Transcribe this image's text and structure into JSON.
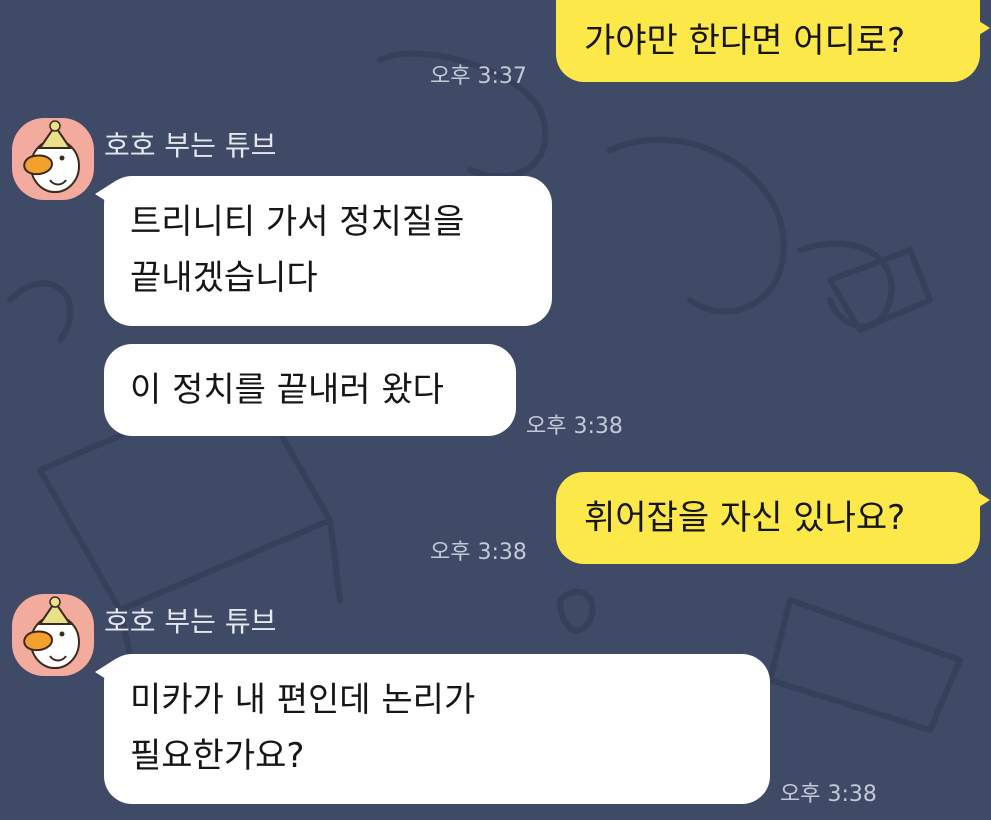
{
  "chat": {
    "sender_name": "호호 부는 튜브",
    "messages": [
      {
        "side": "sent",
        "lines": [
          "가야만 한다면 어디로?"
        ],
        "time": "오후 3:37"
      },
      {
        "side": "recv",
        "lines": [
          "트리니티 가서 정치질을",
          "끝내겠습니다"
        ]
      },
      {
        "side": "recv",
        "lines": [
          "이 정치를 끝내러 왔다"
        ],
        "time": "오후 3:38"
      },
      {
        "side": "sent",
        "lines": [
          "휘어잡을 자신 있나요?"
        ],
        "time": "오후 3:38"
      },
      {
        "side": "recv",
        "lines": [
          "미카가 내 편인데 논리가",
          "필요한가요?"
        ],
        "time": "오후 3:38"
      }
    ]
  },
  "colors": {
    "background": "#3f4a66",
    "sent_bubble": "#fde84a",
    "recv_bubble": "#ffffff",
    "avatar_bg": "#f3ab9d"
  },
  "icons": {
    "avatar": "tube-duck-character-icon"
  }
}
